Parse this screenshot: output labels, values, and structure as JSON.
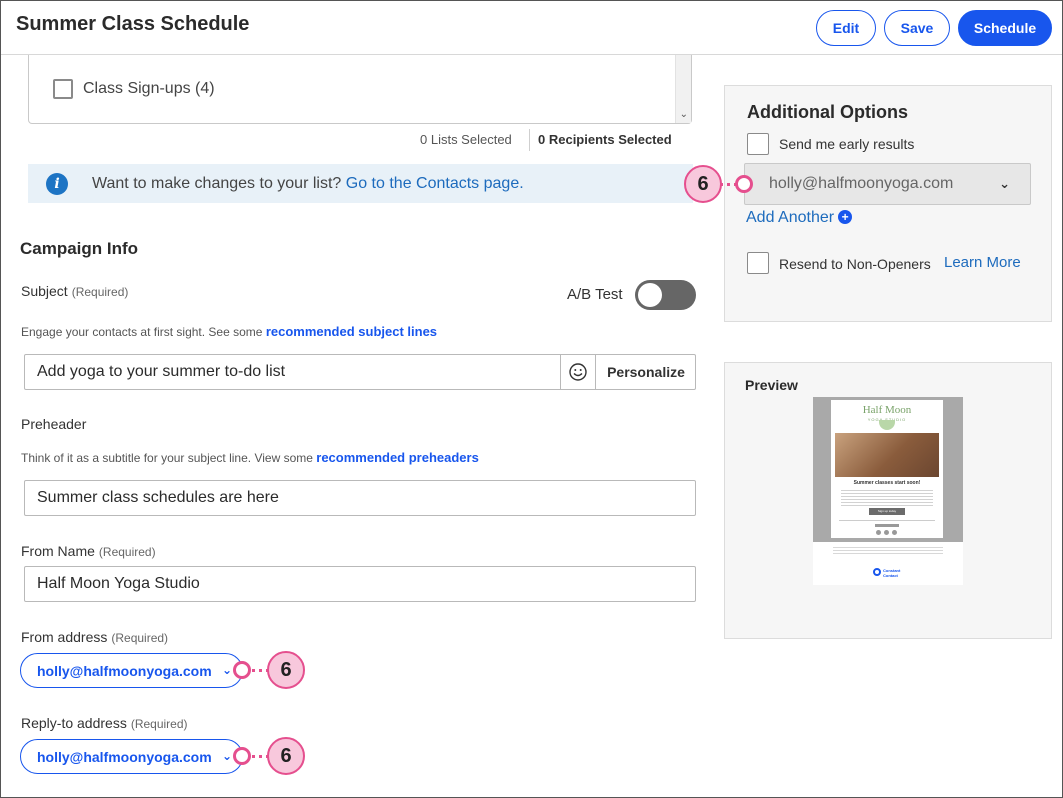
{
  "header": {
    "title": "Summer Class Schedule",
    "edit_label": "Edit",
    "save_label": "Save",
    "schedule_label": "Schedule"
  },
  "lists": {
    "item_label": "Class Sign-ups (4)",
    "lists_selected": "0 Lists Selected",
    "recipients_selected": "0 Recipients Selected"
  },
  "banner": {
    "icon": "info-icon",
    "text": "Want to make changes to your list?",
    "link": "Go to the Contacts page."
  },
  "campaign": {
    "section_title": "Campaign Info",
    "subject_label": "Subject",
    "required_tag": "(Required)",
    "ab_test_label": "A/B Test",
    "ab_test_on": false,
    "subject_help": "Engage your contacts at first sight. See some",
    "subject_help_link": "recommended subject lines",
    "subject_value": "Add yoga to your summer to-do list",
    "emoji_icon": "smiley-icon",
    "personalize_label": "Personalize",
    "preheader_label": "Preheader",
    "preheader_help": "Think of it as a subtitle for your subject line. View some",
    "preheader_help_link": "recommended preheaders",
    "preheader_value": "Summer class schedules are here",
    "from_name_label": "From Name",
    "from_name_value": "Half Moon Yoga Studio",
    "from_address_label": "From address",
    "from_address_value": "holly@halfmoonyoga.com",
    "reply_to_label": "Reply-to address",
    "reply_to_value": "holly@halfmoonyoga.com"
  },
  "options": {
    "title": "Additional Options",
    "early_results_label": "Send me early results",
    "early_results_email": "holly@halfmoonyoga.com",
    "add_another_label": "Add Another",
    "resend_label": "Resend to Non-Openers",
    "learn_more_label": "Learn More"
  },
  "preview": {
    "title": "Preview",
    "brand_line1": "Half Moon",
    "brand_line2": "YOGA STUDIO",
    "headline": "Summer classes start soon!",
    "button": "Sign up today",
    "footer_brand": "Constant Contact"
  },
  "callouts": {
    "number": "6"
  },
  "colors": {
    "accent": "#1856ed",
    "callout_fill": "#f8c8dc",
    "callout_border": "#e54f8e",
    "banner_bg": "#e8f1f8"
  }
}
